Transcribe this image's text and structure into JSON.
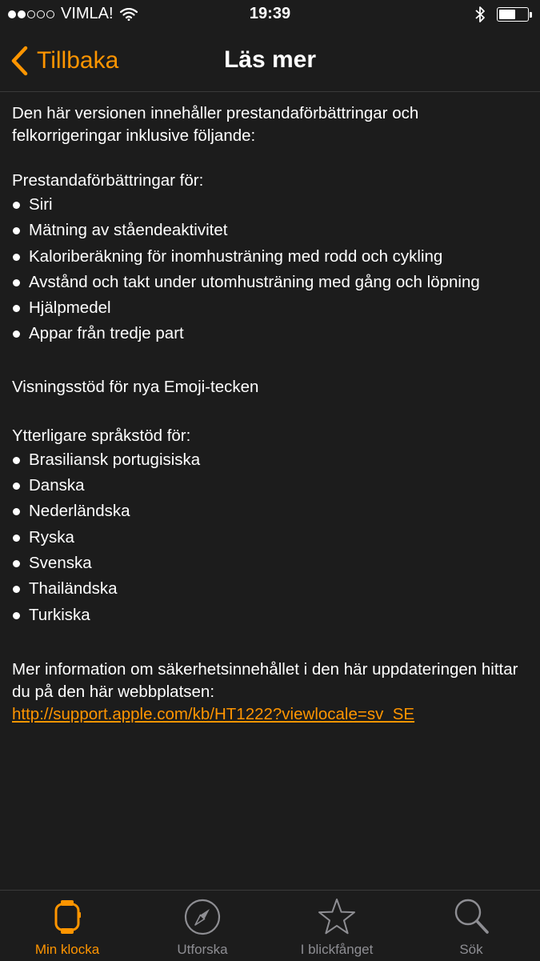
{
  "status_bar": {
    "carrier": "VIMLA!",
    "time": "19:39",
    "signal_bars_filled": 2,
    "signal_bars_total": 5,
    "battery_level": 0.55
  },
  "nav": {
    "back_label": "Tillbaka",
    "title": "Läs mer"
  },
  "content": {
    "intro": "Den här versionen innehåller prestandaförbättringar och felkorrigeringar inklusive följande:",
    "perf_heading": "Prestandaförbättringar för:",
    "perf_items": [
      "Siri",
      "Mätning av ståendeaktivitet",
      "Kaloriberäkning för inomhusträning med rodd och cykling",
      "Avstånd och takt under utomhusträning med gång och löpning",
      "Hjälpmedel",
      "Appar från tredje part"
    ],
    "emoji_text": "Visningsstöd för nya Emoji-tecken",
    "lang_heading": "Ytterligare språkstöd för:",
    "lang_items": [
      "Brasiliansk portugisiska",
      "Danska",
      "Nederländska",
      "Ryska",
      "Svenska",
      "Thailändska",
      "Turkiska"
    ],
    "security_text": "Mer information om säkerhetsinnehållet i den här uppdateringen hittar du på den här webbplatsen:",
    "security_link": "http://support.apple.com/kb/HT1222?viewlocale=sv_SE"
  },
  "tab_bar": {
    "tabs": [
      {
        "label": "Min klocka",
        "icon": "watch-icon",
        "active": true
      },
      {
        "label": "Utforska",
        "icon": "compass-icon",
        "active": false
      },
      {
        "label": "I blickfånget",
        "icon": "star-icon",
        "active": false
      },
      {
        "label": "Sök",
        "icon": "search-icon",
        "active": false
      }
    ]
  },
  "colors": {
    "accent": "#ff9500",
    "background": "#1c1c1c",
    "inactive": "#8e8e93"
  }
}
